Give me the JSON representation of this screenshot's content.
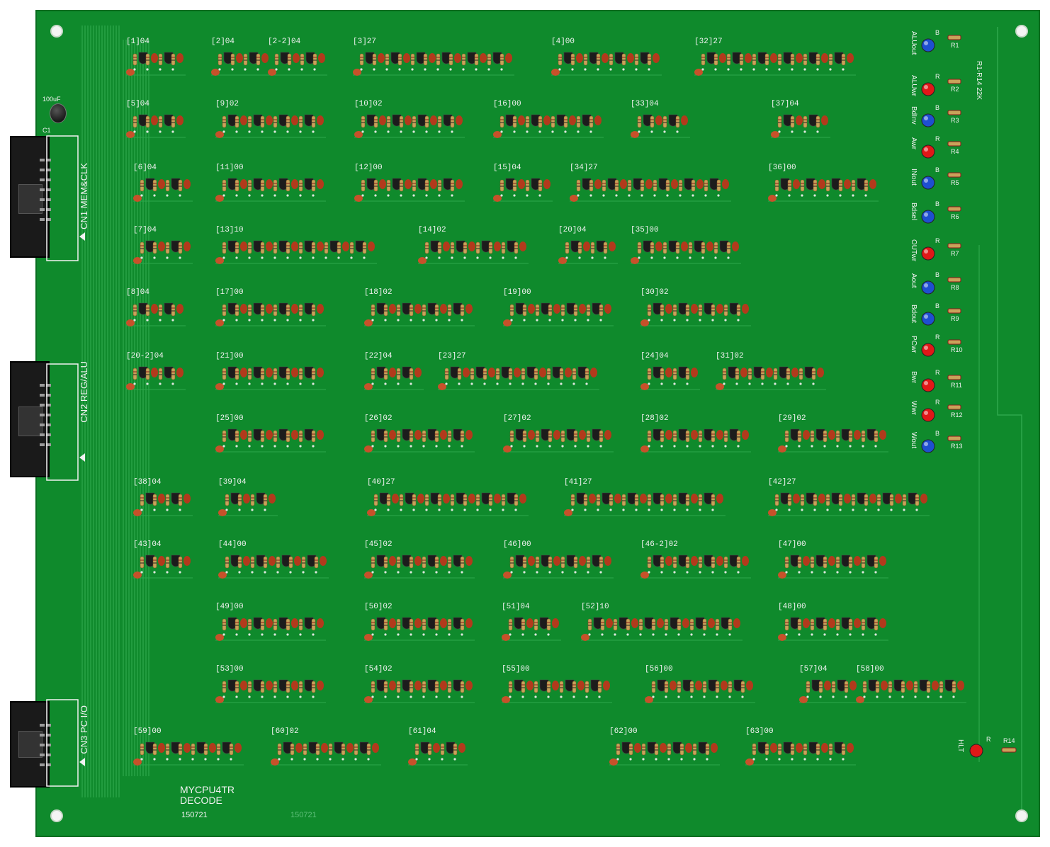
{
  "board": {
    "title": "MYCPU4TR",
    "subtitle": "DECODE",
    "date": "150721",
    "date_faint": "150721",
    "colors": {
      "pcb": "#0f8a2c",
      "silk": "#f2f2f2",
      "trace": "#2ea84c",
      "transistor": "#1c1c1c",
      "resistor": "#c9a25a",
      "capacitor": "#c7512a",
      "led_red": "#e01818",
      "led_blue": "#1e4fd0"
    }
  },
  "connectors": [
    {
      "ref": "CN1",
      "label": "CN1 MEM&CLK"
    },
    {
      "ref": "CN2",
      "label": "CN2 REG/ALU"
    },
    {
      "ref": "CN3",
      "label": "CN3 PC I/O"
    }
  ],
  "c1": {
    "ref": "C1",
    "value": "100uF"
  },
  "resistor_note": "R1-R14 22K",
  "blocks": [
    "[1]04",
    "[2]04",
    "[2-2]04",
    "[3]27",
    "[4]00",
    "[32]27",
    "[5]04",
    "[9]02",
    "[10]02",
    "[16]00",
    "[33]04",
    "[37]04",
    "[6]04",
    "[11]00",
    "[12]00",
    "[15]04",
    "[34]27",
    "[36]00",
    "[7]04",
    "[13]10",
    "[14]02",
    "[20]04",
    "[35]00",
    "[8]04",
    "[17]00",
    "[18]02",
    "[19]00",
    "[30]02",
    "[20-2]04",
    "[21]00",
    "[22]04",
    "[23]27",
    "[24]04",
    "[31]02",
    "[25]00",
    "[26]02",
    "[27]02",
    "[28]02",
    "[29]02",
    "[38]04",
    "[39]04",
    "[40]27",
    "[41]27",
    "[42]27",
    "[43]04",
    "[44]00",
    "[45]02",
    "[46]00",
    "[46-2]02",
    "[47]00",
    "[49]00",
    "[50]02",
    "[51]04",
    "[52]10",
    "[48]00",
    "[53]00",
    "[54]02",
    "[55]00",
    "[56]00",
    "[57]04",
    "[58]00",
    "[59]00",
    "[60]02",
    "[61]04",
    "[62]00",
    "[63]00"
  ],
  "leds": [
    {
      "signal": "ALUout",
      "color": "B",
      "ref": "R1"
    },
    {
      "signal": "ALUwr",
      "color": "R",
      "ref": "R2"
    },
    {
      "signal": "BdInv",
      "color": "B",
      "ref": "R3"
    },
    {
      "signal": "Awr",
      "color": "R",
      "ref": "R4"
    },
    {
      "signal": "INout",
      "color": "B",
      "ref": "R5"
    },
    {
      "signal": "Bdsel",
      "color": "B",
      "ref": "R6"
    },
    {
      "signal": "OUTwr",
      "color": "R",
      "ref": "R7"
    },
    {
      "signal": "Aout",
      "color": "B",
      "ref": "R8"
    },
    {
      "signal": "Bdout",
      "color": "B",
      "ref": "R9"
    },
    {
      "signal": "PCwr",
      "color": "R",
      "ref": "R10"
    },
    {
      "signal": "Bwr",
      "color": "R",
      "ref": "R11"
    },
    {
      "signal": "Wwr",
      "color": "R",
      "ref": "R12"
    },
    {
      "signal": "Wout",
      "color": "B",
      "ref": "R13"
    }
  ],
  "hlt": {
    "signal": "HLT",
    "color": "R",
    "ref": "R14"
  }
}
